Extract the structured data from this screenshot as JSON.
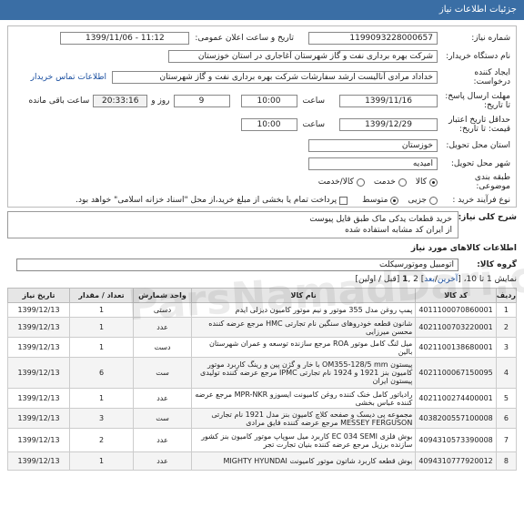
{
  "header": {
    "title": "جزئیات اطلاعات نیاز"
  },
  "form": {
    "need_number_label": "شماره نیاز:",
    "need_number": "1199093228000657",
    "announce_label": "تاریخ و ساعت اعلان عمومی:",
    "announce_value": "1399/11/06 - 11:12",
    "buyer_label": "نام دستگاه خریدار:",
    "buyer": "شرکت بهره برداری نفت و گاز شهرستان آغاجاری در استان خوزستان",
    "creator_label": "ایجاد کننده درخواست:",
    "creator": "خداداد  مرادی آنالیست ارشد سفارشات شرکت بهره برداری نفت و گاز شهرستان",
    "contact_link": "اطلاعات تماس خریدار",
    "deadline_label": "مهلت ارسال پاسخ: تا تاریخ:",
    "deadline_date": "1399/11/16",
    "time_label": "ساعت",
    "deadline_time": "10:00",
    "days": "9",
    "days_suffix": "روز و",
    "remaining": "20:33:16",
    "remaining_suffix": "ساعت باقی مانده",
    "validity_label": "حداقل تاریخ اعتبار قیمت: تا تاریخ:",
    "validity_date": "1399/12/29",
    "validity_time": "10:00",
    "province_label": "استان محل تحویل:",
    "province": "خوزستان",
    "city_label": "شهر محل تحویل:",
    "city": "امیدیه",
    "category_label": "طبقه بندی موضوعی:",
    "category_options": [
      "کالا",
      "خدمت",
      "کالا/خدمت"
    ],
    "process_label": "نوع فرآیند خرید :",
    "process_options": [
      "جزیی",
      "متوسط"
    ],
    "payment_note": "پرداخت تمام یا بخشی از مبلغ خرید،از محل \"اسناد خزانه اسلامی\" خواهد بود."
  },
  "description": {
    "label": "شرح کلی نیاز:",
    "line1": "خرید قطعات یدکی ماک طبق  فایل پیوست",
    "line2": "از ایران کد مشابه استفاده شده"
  },
  "goods": {
    "title": "اطلاعات کالاهای مورد نیاز",
    "group_label": "گروه کالا:",
    "group_value": "اتومبیل وموتورسیکلت",
    "pager_prefix": "نمایش 1 تا 10، [",
    "pager_first": "آخرین",
    "pager_slash": "/",
    "pager_next": "بعد",
    "pager_mid": "] 2 ,",
    "pager_current": "1",
    "pager_suffix": " [قبل / اولین]",
    "columns": [
      "ردیف",
      "کد کالا",
      "نام کالا",
      "واحد شمارش",
      "تعداد / مقدار",
      "تاریخ نیاز"
    ],
    "rows": [
      {
        "n": "1",
        "code": "4011100070860001",
        "name": "پمپ روغن مدل 355 موتور و نیم موتور کامیون دیزلی ایدم",
        "unit": "دستی",
        "qty": "1",
        "date": "1399/12/13"
      },
      {
        "n": "2",
        "code": "4021100703220001",
        "name": "شانون قطعه خودروهای سنگین نام تجارتی HMC مرجع عرضه کننده محسن میرزایی",
        "unit": "عدد",
        "qty": "1",
        "date": "1399/12/13"
      },
      {
        "n": "3",
        "code": "4021100138680001",
        "name": "میل لنگ کامل موتور ROA مرجع سازنده توسعه و عمران شهرستان بالین",
        "unit": "دست",
        "qty": "1",
        "date": "1399/12/13"
      },
      {
        "n": "4",
        "code": "4021100067150095",
        "name": "پیستون OM355-128/5 mm با خار و گژن پین و رینگ کاربرد موتور کامیون بنز 1921 و 1924 نام تجارتی IPMC مرجع عرضه کننده تولیدی پیستون ایران",
        "unit": "ست",
        "qty": "6",
        "date": "1399/12/13"
      },
      {
        "n": "5",
        "code": "4021100274400001",
        "name": "رادیاتور کامل خنک کننده روغن کامیونت ایسوزو MPR-NKR مرجع عرضه کننده عباس بخشی",
        "unit": "عدد",
        "qty": "1",
        "date": "1399/12/13"
      },
      {
        "n": "6",
        "code": "4038200557100008",
        "name": "مجموعه پی دیسک و صفحه کلاچ کامیون بنز مدل 1921 نام تجارتی MESSEY FERGUSON مرجع عرضه کننده فایق مرادی",
        "unit": "ست",
        "qty": "3",
        "date": "1399/12/13"
      },
      {
        "n": "7",
        "code": "4094310573390008",
        "name": "بوش فلزی EC 034 SEMI کاربرد میل سوپاپ موتور کامیون بنز کشور سازنده برزیل مرجع عرضه کننده بنیان تجارت تجر",
        "unit": "عدد",
        "qty": "2",
        "date": "1399/12/13"
      },
      {
        "n": "8",
        "code": "4094310777920012",
        "name": "بوش قطعه کاربرد شاتون موتور کامیونت MIGHTY HYUNDAI",
        "unit": "عدد",
        "qty": "1",
        "date": "1399/12/13"
      }
    ]
  },
  "watermark": "ParsNamadDari.com"
}
